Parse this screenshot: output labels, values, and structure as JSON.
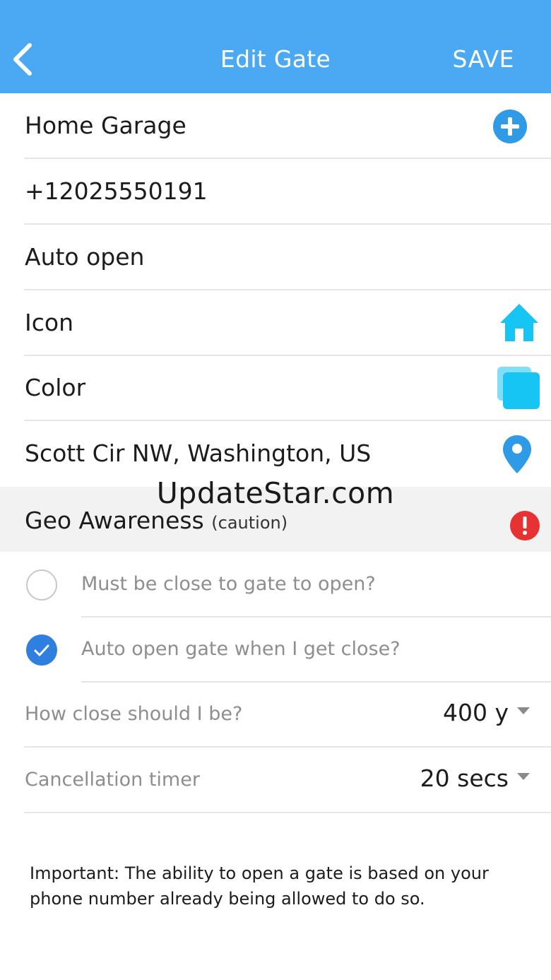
{
  "header": {
    "title": "Edit Gate",
    "save_label": "SAVE",
    "back_icon": "chevron-left-icon"
  },
  "rows": {
    "name": {
      "value": "Home Garage",
      "icon": "add-circle-icon"
    },
    "phone": {
      "value": "+12025550191"
    },
    "auto_open": {
      "label": "Auto open"
    },
    "icon": {
      "label": "Icon",
      "icon": "home-icon"
    },
    "color": {
      "label": "Color",
      "icon": "color-square-icon"
    },
    "address": {
      "value": "Scott Cir NW, Washington, US",
      "icon": "map-pin-icon"
    }
  },
  "geo": {
    "label": "Geo Awareness",
    "caution": "(caution)",
    "icon": "exclamation-icon"
  },
  "watermark": "UpdateStar.com",
  "options": [
    {
      "label": "Must be close to gate to open?",
      "checked": false
    },
    {
      "label": "Auto open gate when I get close?",
      "checked": true
    }
  ],
  "selects": {
    "distance": {
      "label": "How close should I be?",
      "value": "400 y"
    },
    "timer": {
      "label": "Cancellation timer",
      "value": "20 secs"
    }
  },
  "note": "Important: The ability to open a gate is based on your phone number already being allowed to do so.",
  "colors": {
    "header_bg": "#4aa9f2",
    "accent": "#2f9be6",
    "icon_cyan": "#16c5f3",
    "radio_checked": "#2f7fe0",
    "caution_red": "#e63232"
  }
}
